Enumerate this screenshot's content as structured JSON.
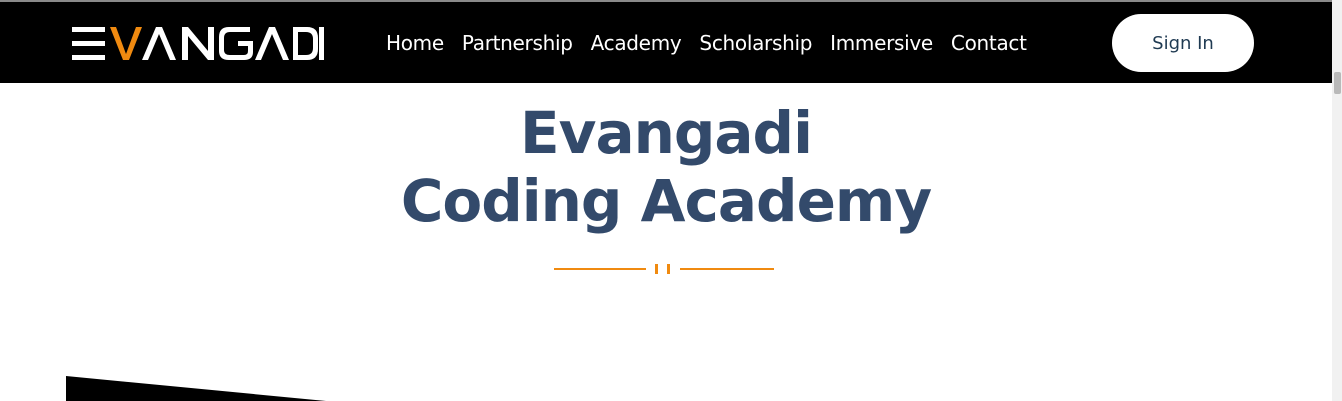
{
  "brand": {
    "logo_text": "EVANGADI",
    "logo_colors": {
      "primary": "#ffffff",
      "accent": "#f08a10"
    }
  },
  "nav": {
    "items": [
      {
        "label": "Home"
      },
      {
        "label": "Partnership"
      },
      {
        "label": "Academy"
      },
      {
        "label": "Scholarship"
      },
      {
        "label": "Immersive"
      },
      {
        "label": "Contact"
      }
    ],
    "signin_label": "Sign In"
  },
  "hero": {
    "title_line1": "Evangadi",
    "title_line2": "Coding Academy"
  },
  "colors": {
    "navbar_bg": "#000000",
    "title": "#334a6b",
    "accent": "#f08a10",
    "signin_text": "#1f3a52"
  },
  "icons": {
    "divider": "divider-ornament-icon",
    "decor": "decorative-wedge-shape"
  }
}
